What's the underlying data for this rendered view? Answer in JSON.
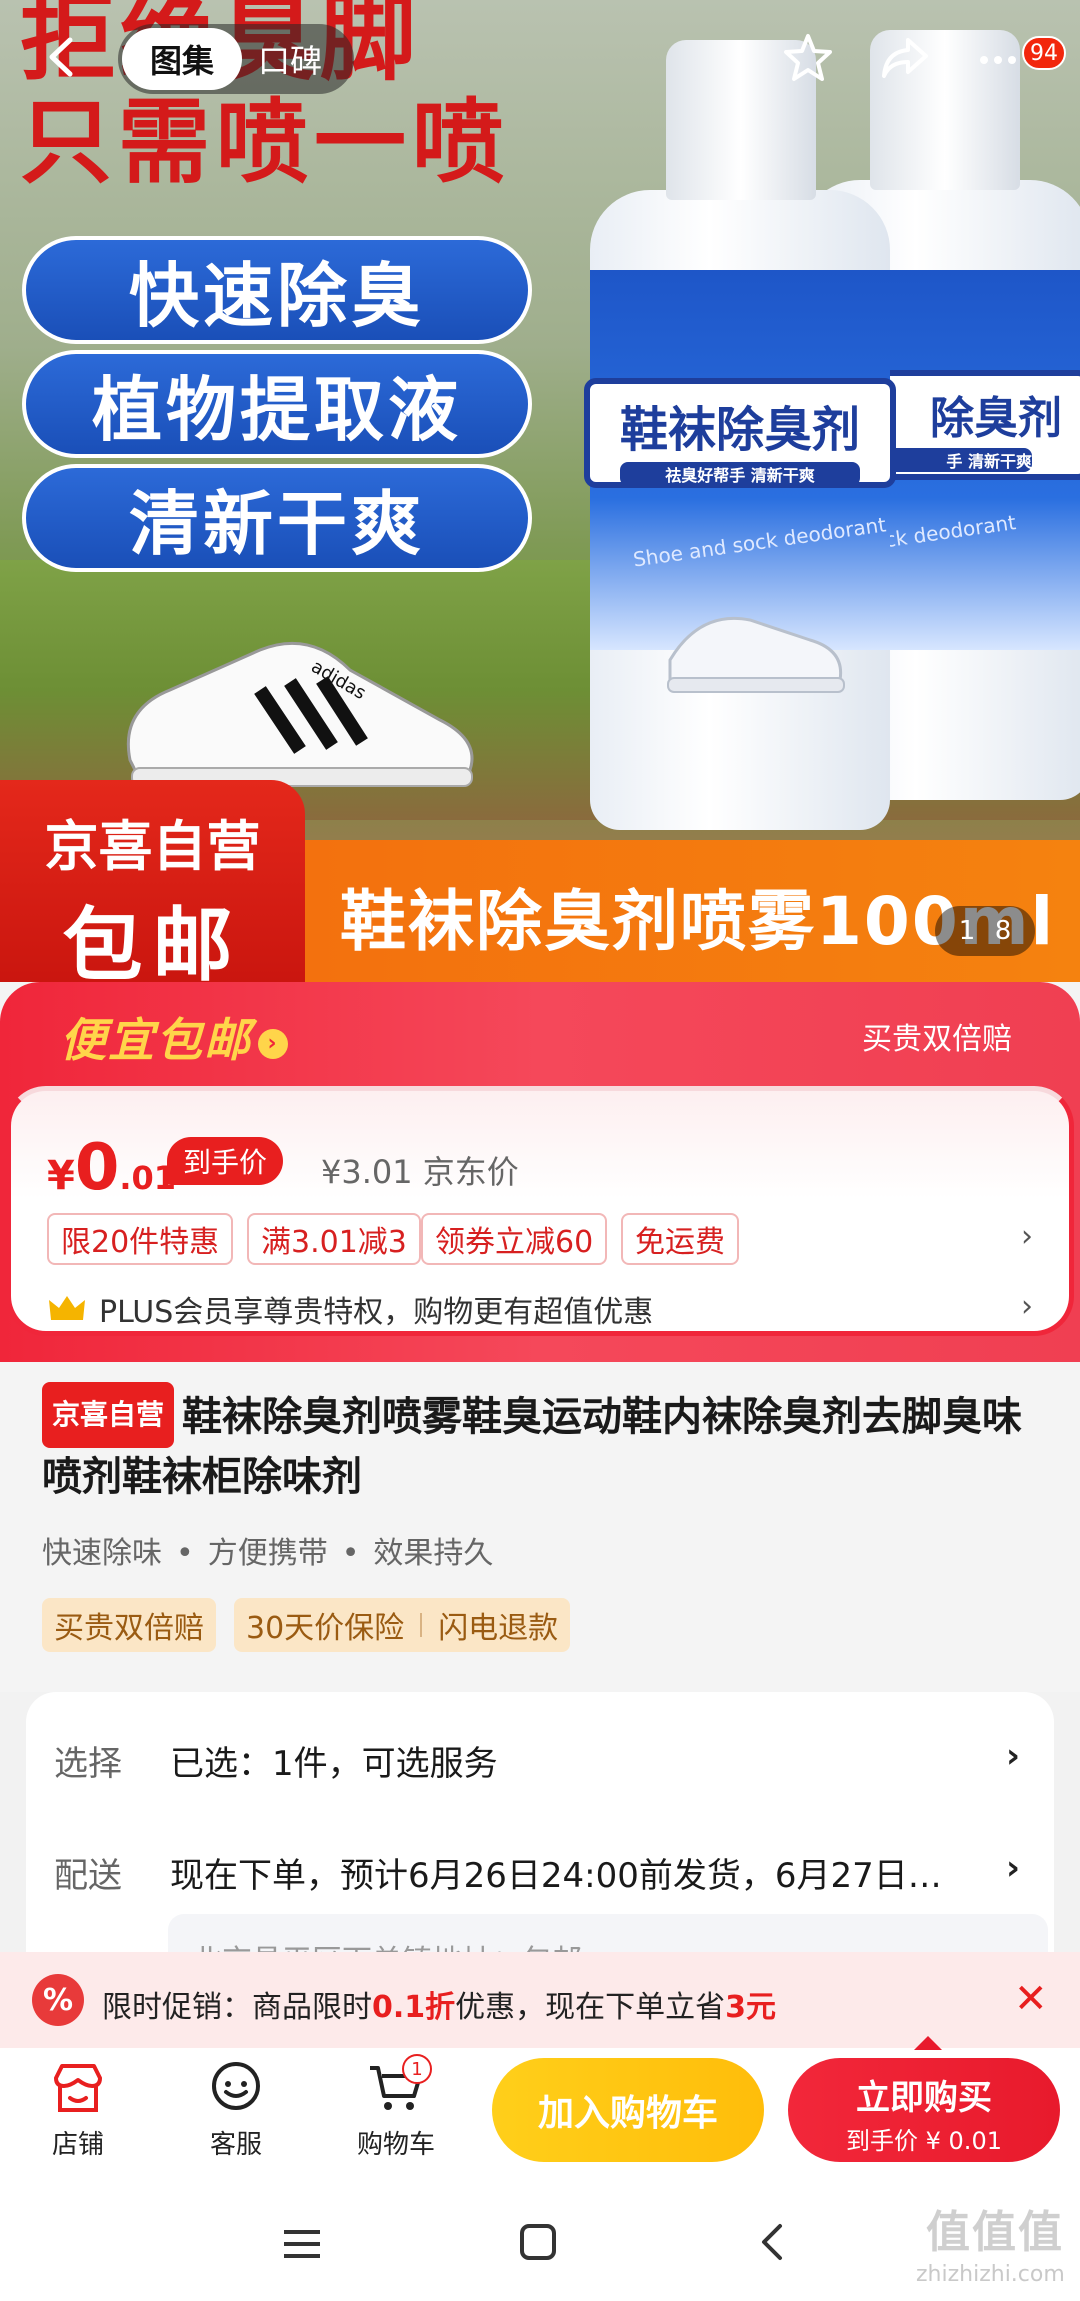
{
  "nav": {
    "tab_active": "图集",
    "tab_other": "口碑",
    "message_badge": "94"
  },
  "hero": {
    "headline_top": "拒绝臭脚",
    "headline": "只需喷一喷",
    "pills": [
      "快速除臭",
      "植物提取液",
      "清新干爽"
    ],
    "bottle_label": "鞋袜除臭剂",
    "bottle_label_cropped": "除臭剂",
    "bottle_sub": "祛臭好帮手 清新干爽",
    "bottle_sub_cropped": "手 清新干爽",
    "bottle_en": "Shoe and sock deodorant",
    "bottle_en_cropped": "ock deodorant",
    "shoe_brand": "adidas",
    "jd_box_line1": "京喜自营",
    "jd_box_line2": "包邮",
    "orange_text": "鞋袜除臭剂喷雾100ml",
    "counter_current": "1",
    "counter_total": "8"
  },
  "promo": {
    "title": "便宜包邮",
    "right": "买贵双倍赔",
    "price_symbol": "¥",
    "price_int": "0",
    "price_dec": ".01",
    "hand_price_label": "到手价",
    "jd_price": "¥3.01 京东价",
    "chips": [
      "限20件特惠",
      "满3.01减3",
      "领券立减60",
      "免运费"
    ],
    "plus_text": "PLUS会员享尊贵特权，购物更有超值优惠"
  },
  "product": {
    "self_tag": "京喜自营",
    "title": "鞋袜除臭剂喷雾鞋臭运动鞋内袜除臭剂去脚臭味喷剂鞋袜柜除味剂",
    "features": [
      "快速除味",
      "方便携带",
      "效果持久"
    ],
    "service_tag_1": "买贵双倍赔",
    "service_tag_2a": "30天价保险",
    "service_tag_2b": "闪电退款"
  },
  "select": {
    "choose_label": "选择",
    "choose_value": "已选：1件，可选服务",
    "delivery_label": "配送",
    "delivery_value": "现在下单，预计6月26日24:00前发货，6月27日…",
    "sub_box": "北京昌平区下单镇地址：包邮"
  },
  "limit": {
    "icon": "%",
    "text_a": "限时促销：商品限时",
    "text_b": "0.1折",
    "text_c": "优惠，现在下单立省",
    "text_d": "3元"
  },
  "actions": {
    "shop": "店铺",
    "service": "客服",
    "cart": "购物车",
    "cart_count": "1",
    "add_cart": "加入购物车",
    "buy_now": "立即购买",
    "buy_sub": "到手价 ¥ 0.01"
  },
  "watermark": {
    "big": "值值值",
    "small": "zhizhizhi.com"
  }
}
